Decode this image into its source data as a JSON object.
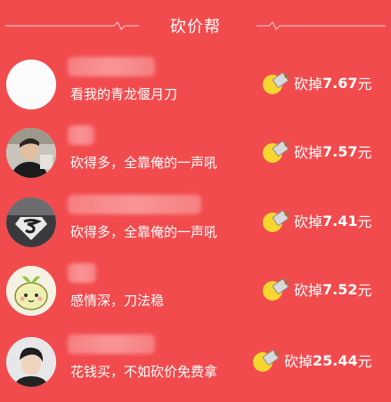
{
  "header": {
    "title": "砍价帮"
  },
  "colors": {
    "background": "#f24b4e",
    "coin": "#f7d630"
  },
  "rows": [
    {
      "message": "看我的青龙偃月刀",
      "cut_label": "砍掉",
      "amount": "7.67",
      "unit": "元",
      "avatar_icon": "blank-avatar"
    },
    {
      "message": "砍得多，全靠俺的一声吼",
      "cut_label": "砍掉",
      "amount": "7.57",
      "unit": "元",
      "avatar_icon": "man-photo-avatar"
    },
    {
      "message": "砍得多，全靠俺的一声吼",
      "cut_label": "砍掉",
      "amount": "7.41",
      "unit": "元",
      "avatar_icon": "superman-logo-avatar"
    },
    {
      "message": "感情深，刀法稳",
      "cut_label": "砍掉",
      "amount": "7.52",
      "unit": "元",
      "avatar_icon": "cartoon-sprout-avatar"
    },
    {
      "message": "花钱买，不如砍价免费拿",
      "cut_label": "砍掉",
      "amount": "25.44",
      "unit": "元",
      "avatar_icon": "boy-photo-avatar"
    }
  ]
}
